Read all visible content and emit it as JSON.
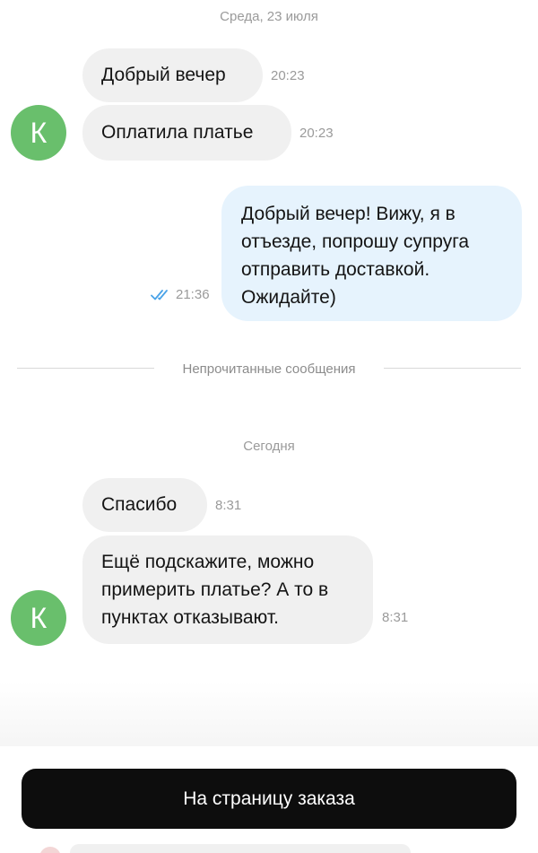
{
  "chat": {
    "date_separator_1": "Среда, 23 июля",
    "msg1": {
      "text": "Добрый вечер",
      "time": "20:23"
    },
    "msg2": {
      "text": "Оплатила платье",
      "time": "20:23"
    },
    "avatar1_letter": "К",
    "msg3": {
      "lines": [
        "Добрый вечер! Вижу, я в",
        "отъезде, попрошу супруга",
        "отправить доставкой.",
        "Ожидайте)"
      ],
      "time": "21:36",
      "status_icon": "double-check-icon"
    },
    "unread_label": "Непрочитанные сообщения",
    "date_separator_2": "Сегодня",
    "msg4": {
      "text": "Спасибо",
      "time": "8:31"
    },
    "msg5": {
      "lines": [
        "Ещё подскажите, можно",
        "примерить платье? А то в",
        "пунктах отказывают."
      ],
      "time": "8:31"
    },
    "avatar2_letter": "К"
  },
  "bottom": {
    "order_button_label": "На страницу заказа"
  },
  "colors": {
    "avatar_bg": "#69bf6c",
    "incoming_bubble": "#f0f0f0",
    "outgoing_bubble": "#e6f3fd",
    "read_check": "#4aa3e8",
    "button_bg": "#0d0d0d"
  }
}
